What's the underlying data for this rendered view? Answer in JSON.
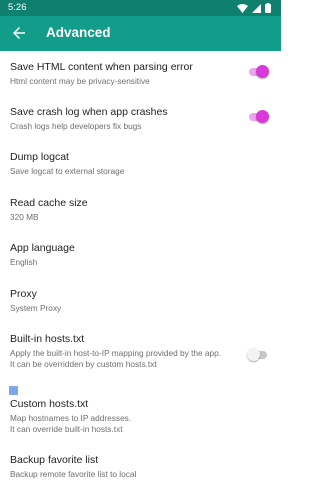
{
  "status_bar": {
    "time": "5:26",
    "icons": [
      "wifi-icon",
      "signal-icon",
      "battery-icon"
    ]
  },
  "app_bar": {
    "title": "Advanced",
    "back_icon": "arrow-left-icon"
  },
  "colors": {
    "status_bar": "#0f806f",
    "app_bar": "#129d8a",
    "switch_on": "#d93ad7",
    "switch_off": "#f3f3f3"
  },
  "settings": [
    {
      "title": "Save HTML content when parsing error",
      "summary": "Html content may be privacy-sensitive",
      "switch": "on"
    },
    {
      "title": "Save crash log when app crashes",
      "summary": "Crash logs help developers fix bugs",
      "switch": "on"
    },
    {
      "title": "Dump logcat",
      "summary": "Save logcat to external storage"
    },
    {
      "title": "Read cache size",
      "summary": "320 MB"
    },
    {
      "title": "App language",
      "summary": "English"
    },
    {
      "title": "Proxy",
      "summary": "System Proxy"
    },
    {
      "title": "Built-in hosts.txt",
      "summary": "Apply the built-in host-to-IP mapping provided by the app.",
      "summary2": "It can be overridden by custom hosts.txt",
      "switch": "off"
    },
    {
      "title": "Custom hosts.txt",
      "summary": "Map hostnames to IP addresses.",
      "summary2": "It can override built-in hosts.txt"
    },
    {
      "title": "Backup favorite list",
      "summary": "Backup remote favorite list to local"
    }
  ]
}
